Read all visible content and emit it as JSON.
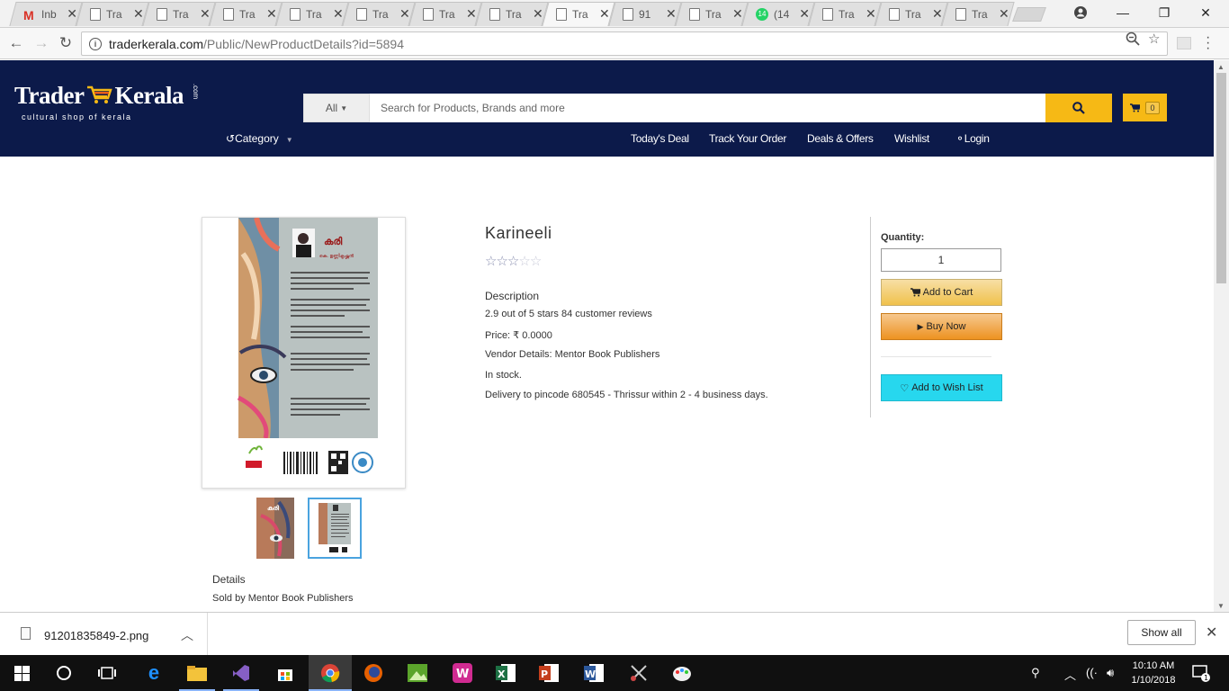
{
  "browser": {
    "tabs": [
      {
        "label": "Inb",
        "type": "gmail",
        "active": false
      },
      {
        "label": "Tra",
        "type": "page",
        "active": false
      },
      {
        "label": "Tra",
        "type": "page",
        "active": false
      },
      {
        "label": "Tra",
        "type": "page",
        "active": false
      },
      {
        "label": "Tra",
        "type": "page",
        "active": false
      },
      {
        "label": "Tra",
        "type": "page",
        "active": false
      },
      {
        "label": "Tra",
        "type": "page",
        "active": false
      },
      {
        "label": "Tra",
        "type": "page",
        "active": false
      },
      {
        "label": "Tra",
        "type": "page",
        "active": true
      },
      {
        "label": "91",
        "type": "page",
        "active": false
      },
      {
        "label": "Tra",
        "type": "page",
        "active": false
      },
      {
        "label": "(14",
        "type": "whatsapp",
        "badge": "14",
        "active": false
      },
      {
        "label": "Tra",
        "type": "page",
        "active": false
      },
      {
        "label": "Tra",
        "type": "page",
        "active": false
      },
      {
        "label": "Tra",
        "type": "page",
        "active": false
      }
    ],
    "url_host": "traderkerala.com",
    "url_path": "/Public/NewProductDetails?id=5894"
  },
  "site": {
    "logo_left": "Trader",
    "logo_right": "Kerala",
    "logo_com": ".com",
    "tagline": "cultural shop of kerala",
    "search_category": "All",
    "search_placeholder": "Search for Products, Brands and more",
    "cart_count": "0",
    "category_label": "Category",
    "nav": [
      "Today's Deal",
      "Track Your Order",
      "Deals & Offers",
      "Wishlist",
      "Login"
    ],
    "brand_color": "#0c1a4a",
    "accent_color": "#f6b915"
  },
  "product": {
    "title": "Karineeli",
    "rating_stars": 3,
    "rating_max": 5,
    "description_heading": "Description",
    "rating_text": "2.9 out of 5 stars 84 customer reviews",
    "price": "Price: ₹ 0.0000",
    "vendor": "Vendor Details: Mentor Book Publishers",
    "stock": "In stock.",
    "delivery": "Delivery to pincode 680545 - Thrissur within 2 - 4 business days.",
    "details_label": "Details",
    "sold_by": "Sold by Mentor Book Publishers"
  },
  "purchase": {
    "quantity_label": "Quantity:",
    "quantity_value": "1",
    "add_to_cart": "Add to Cart",
    "buy_now": "Buy Now",
    "add_to_wishlist": "Add to Wish List"
  },
  "downloads": {
    "file_name": "91201835849-2.png",
    "show_all": "Show all"
  },
  "taskbar": {
    "time": "10:10 AM",
    "date": "1/10/2018",
    "notifications": "1"
  }
}
